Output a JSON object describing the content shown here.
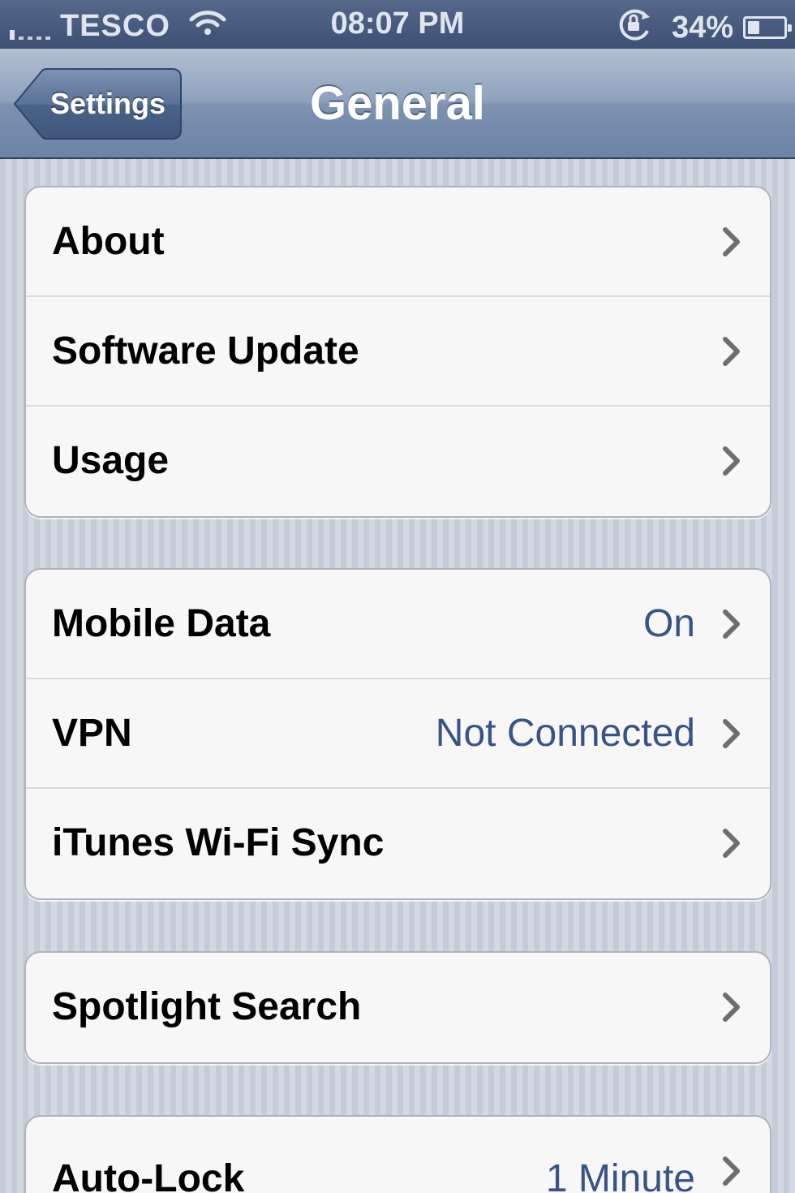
{
  "status_bar": {
    "carrier": "TESCO",
    "time": "08:07 PM",
    "battery_percent": "34%",
    "battery_level": 0.34,
    "signal_icon": "signal-bars-icon",
    "wifi_icon": "wifi-icon",
    "rotation_lock_icon": "rotation-lock-icon"
  },
  "nav": {
    "back_label": "Settings",
    "title": "General"
  },
  "groups": [
    {
      "rows": [
        {
          "label": "About",
          "value": ""
        },
        {
          "label": "Software Update",
          "value": ""
        },
        {
          "label": "Usage",
          "value": ""
        }
      ]
    },
    {
      "rows": [
        {
          "label": "Mobile Data",
          "value": "On"
        },
        {
          "label": "VPN",
          "value": "Not Connected"
        },
        {
          "label": "iTunes Wi-Fi Sync",
          "value": ""
        }
      ]
    },
    {
      "rows": [
        {
          "label": "Spotlight Search",
          "value": ""
        }
      ]
    },
    {
      "rows": [
        {
          "label": "Auto-Lock",
          "value": "1 Minute"
        }
      ]
    }
  ],
  "colors": {
    "value_text": "#385487",
    "nav_bar": "#7d92b1",
    "status_bar": "#3d5074"
  }
}
